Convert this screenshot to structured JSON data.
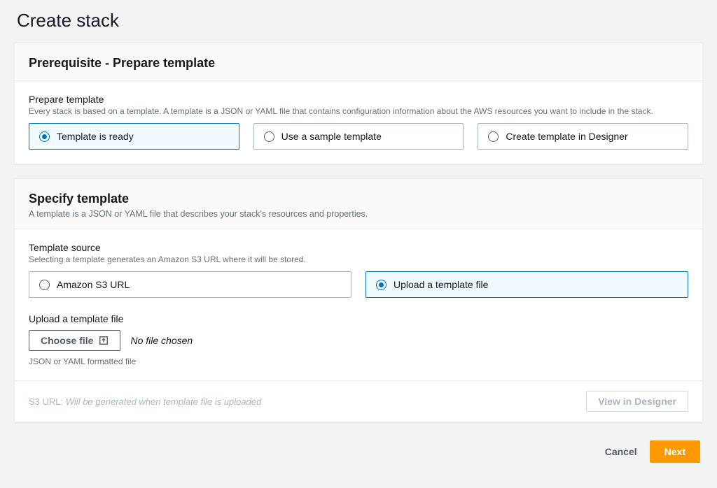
{
  "page": {
    "title": "Create stack"
  },
  "prereq": {
    "heading": "Prerequisite - Prepare template",
    "field_label": "Prepare template",
    "field_desc": "Every stack is based on a template. A template is a JSON or YAML file that contains configuration information about the AWS resources you want to include in the stack.",
    "options": {
      "ready": "Template is ready",
      "sample": "Use a sample template",
      "designer": "Create template in Designer"
    },
    "selected": "ready"
  },
  "specify": {
    "heading": "Specify template",
    "desc": "A template is a JSON or YAML file that describes your stack's resources and properties.",
    "source_label": "Template source",
    "source_desc": "Selecting a template generates an Amazon S3 URL where it will be stored.",
    "options": {
      "s3": "Amazon S3 URL",
      "upload": "Upload a template file"
    },
    "selected": "upload",
    "upload_label": "Upload a template file",
    "choose_file": "Choose file",
    "no_file": "No file chosen",
    "hint": "JSON or YAML formatted file",
    "s3_label": "S3 URL:",
    "s3_value": "Will be generated when template file is uploaded",
    "view_designer": "View in Designer"
  },
  "actions": {
    "cancel": "Cancel",
    "next": "Next"
  }
}
